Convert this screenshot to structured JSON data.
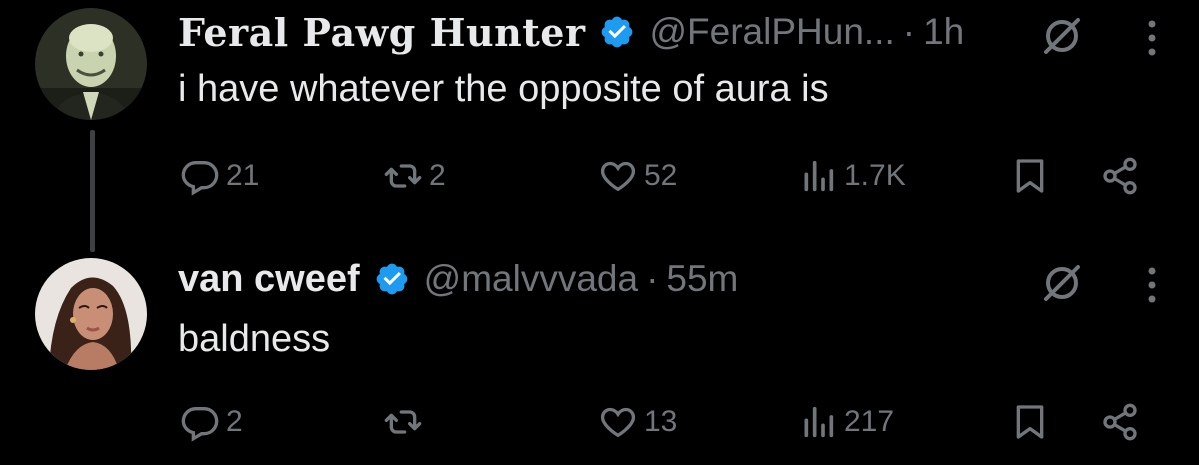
{
  "tweets": [
    {
      "name": "Feral Pawg Hunter",
      "handle": "@FeralPHun...",
      "separator": "·",
      "time": "1h",
      "text": "i have whatever the opposite of aura is",
      "verified": true,
      "stats": {
        "replies": "21",
        "retweets": "2",
        "likes": "52",
        "views": "1.7K"
      }
    },
    {
      "name": "van cweef",
      "handle": "@malvvvada",
      "separator": "·",
      "time": "55m",
      "text": "baldness",
      "verified": true,
      "stats": {
        "replies": "2",
        "retweets": "",
        "likes": "13",
        "views": "217"
      }
    }
  ],
  "colors": {
    "background": "#000000",
    "text": "#e7e9ea",
    "muted": "#71767b",
    "verified": "#1d9bf0",
    "thread_line": "#3e4144"
  },
  "icons": [
    "verified-badge-icon",
    "mute-icon",
    "more-icon",
    "reply-icon",
    "retweet-icon",
    "like-icon",
    "views-icon",
    "bookmark-icon",
    "share-icon"
  ]
}
